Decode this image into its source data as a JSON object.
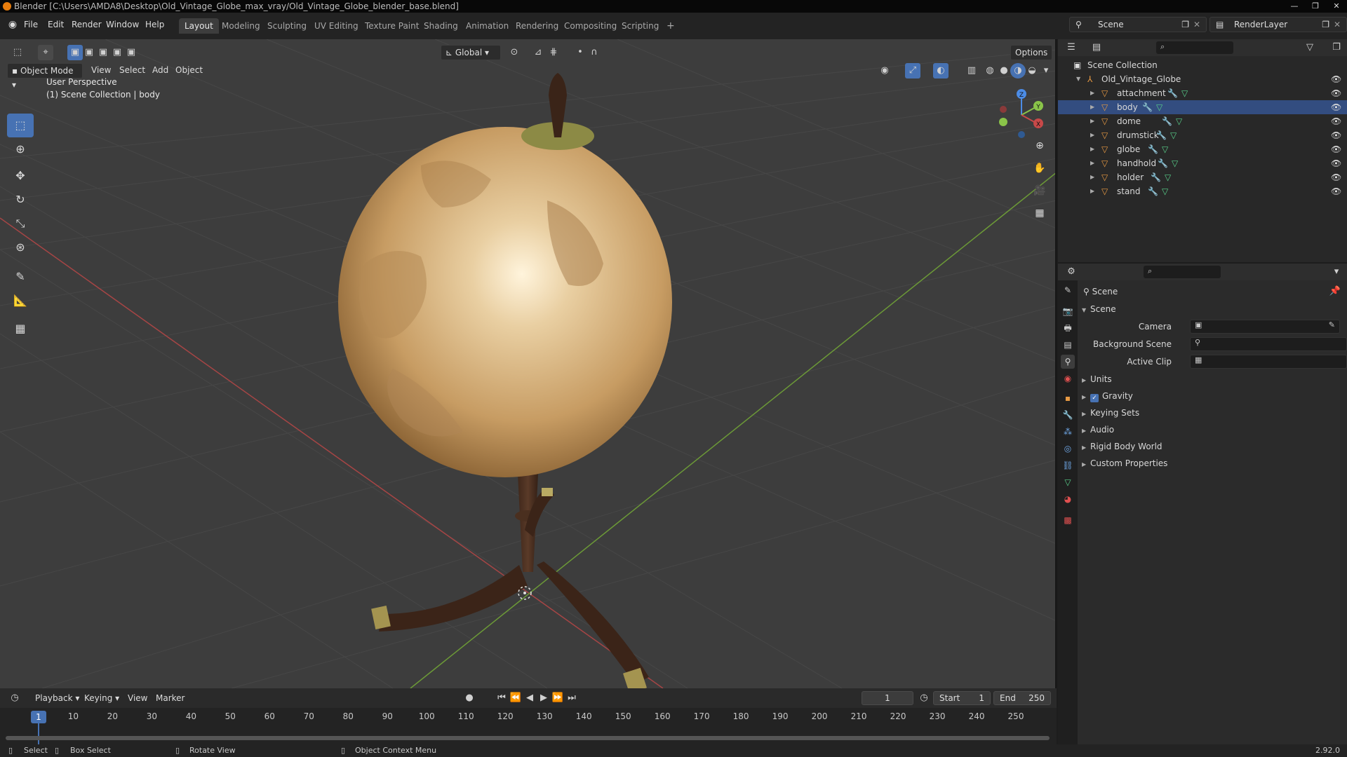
{
  "window": {
    "title": "Blender [C:\\Users\\AMDA8\\Desktop\\Old_Vintage_Globe_max_vray/Old_Vintage_Globe_blender_base.blend]",
    "controls": [
      "—",
      "❐",
      "✕"
    ]
  },
  "menu": {
    "file": "File",
    "edit": "Edit",
    "render": "Render",
    "window": "Window",
    "help": "Help"
  },
  "workspaces": [
    "Layout",
    "Modeling",
    "Sculpting",
    "UV Editing",
    "Texture Paint",
    "Shading",
    "Animation",
    "Rendering",
    "Compositing",
    "Scripting"
  ],
  "workspace_add": "+",
  "scene_name": "Scene",
  "render_layer": "RenderLayer",
  "viewport": {
    "mode": "Object Mode",
    "menus": [
      "View",
      "Select",
      "Add",
      "Object"
    ],
    "transform_orientation": "Global",
    "options": "Options",
    "overlay_line1": "User Perspective",
    "overlay_line2": "(1) Scene Collection | body",
    "gizmo": {
      "z": "Z",
      "y": "Y",
      "x": "X"
    }
  },
  "outliner": {
    "root": "Scene Collection",
    "collection": "Old_Vintage_Globe",
    "objects": [
      "attachment",
      "body",
      "dome",
      "drumstick",
      "globe",
      "handhold",
      "holder",
      "stand"
    ]
  },
  "properties": {
    "context": "Scene",
    "panel_title": "Scene",
    "fields": {
      "camera": "Camera",
      "background_scene": "Background Scene",
      "active_clip": "Active Clip"
    },
    "subpanels": [
      {
        "label": "Units",
        "checkbox": false
      },
      {
        "label": "Gravity",
        "checkbox": true
      },
      {
        "label": "Keying Sets",
        "checkbox": false
      },
      {
        "label": "Audio",
        "checkbox": false
      },
      {
        "label": "Rigid Body World",
        "checkbox": false
      },
      {
        "label": "Custom Properties",
        "checkbox": false
      }
    ]
  },
  "timeline": {
    "menus": [
      "Playback",
      "Keying",
      "View",
      "Marker"
    ],
    "current_frame": "1",
    "start_label": "Start",
    "start": "1",
    "end_label": "End",
    "end": "250",
    "ticks": [
      "10",
      "20",
      "30",
      "40",
      "50",
      "60",
      "70",
      "80",
      "90",
      "100",
      "110",
      "120",
      "130",
      "140",
      "150",
      "160",
      "170",
      "180",
      "190",
      "200",
      "210",
      "220",
      "230",
      "240",
      "250"
    ]
  },
  "statusbar": {
    "select": "Select",
    "box_select": "Box Select",
    "rotate_view": "Rotate View",
    "context_menu": "Object Context Menu",
    "version": "2.92.0"
  },
  "colors": {
    "accent": "#4772b3",
    "object_icon": "#e89a43",
    "x_axis": "#c84949",
    "y_axis": "#8ac449",
    "z_axis": "#4c8ce6"
  }
}
